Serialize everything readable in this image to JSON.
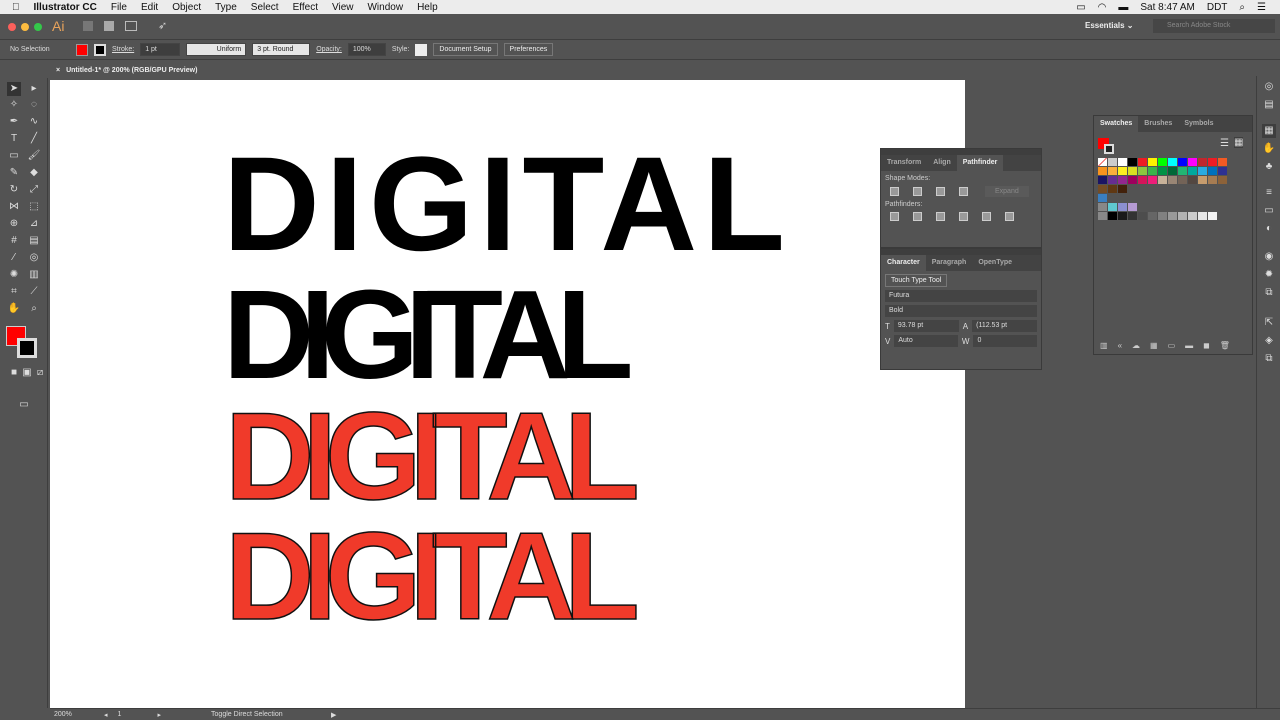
{
  "menubar": {
    "app": "Illustrator CC",
    "items": [
      "File",
      "Edit",
      "Object",
      "Type",
      "Select",
      "Effect",
      "View",
      "Window",
      "Help"
    ],
    "clock": "Sat 8:47 AM",
    "tz": "DDT"
  },
  "appbar": {
    "logo": "Ai",
    "workspace": "Essentials",
    "search_placeholder": "Search Adobe Stock"
  },
  "control": {
    "selection": "No Selection",
    "stroke_label": "Stroke:",
    "stroke_value": "1 pt",
    "profile": "Uniform",
    "brush": "3 pt. Round",
    "opacity_label": "Opacity:",
    "opacity_value": "100%",
    "style_label": "Style:",
    "doc_setup": "Document Setup",
    "preferences": "Preferences",
    "fill_color": "#ff0000"
  },
  "document": {
    "tab": "Untitled-1* @ 200% (RGB/GPU Preview)"
  },
  "artwork": {
    "words": [
      "DIGITAL",
      "DIGITAL",
      "DIGITAL",
      "DIGITAL"
    ],
    "red": "#f03a2a"
  },
  "pathfinder": {
    "tabs": [
      "Transform",
      "Align",
      "Pathfinder"
    ],
    "shape_modes": "Shape Modes:",
    "expand": "Expand",
    "pathfinders": "Pathfinders:"
  },
  "character": {
    "tabs": [
      "Character",
      "Paragraph",
      "OpenType"
    ],
    "touch_type": "Touch Type Tool",
    "font": "Futura",
    "style": "Bold",
    "size": "93.78 pt",
    "leading": "(112.53 pt",
    "kerning": "Auto",
    "tracking": "0"
  },
  "swatches": {
    "tabs": [
      "Swatches",
      "Brushes",
      "Symbols"
    ],
    "colors": [
      "#ffffff",
      "#000000",
      "#ed1c24",
      "#fff200",
      "#00ff00",
      "#00ffff",
      "#0000ff",
      "#ff00ff",
      "#c1272d",
      "#ed1c24",
      "#f15a24",
      "#f7931e",
      "#fbb03b",
      "#fcee21",
      "#d9e021",
      "#8cc63f",
      "#39b54a",
      "#009245",
      "#006837",
      "#22b573",
      "#00a99d",
      "#29abe2",
      "#0071bc",
      "#2e3192",
      "#1b1464",
      "#662d91",
      "#93278f",
      "#9e005d",
      "#d4145a",
      "#ed1e79",
      "#c7b299",
      "#998675",
      "#736357",
      "#534741",
      "#c69c6d",
      "#a67c52",
      "#8c6239",
      "#754c24",
      "#603813",
      "#42210b"
    ],
    "group1": [
      "#5fc8d0",
      "#8b8fd1",
      "#b59ad3"
    ],
    "grays": [
      "#000000",
      "#1a1a1a",
      "#333333",
      "#4d4d4d",
      "#666666",
      "#808080",
      "#999999",
      "#b3b3b3",
      "#cccccc",
      "#e6e6e6",
      "#f2f2f2"
    ]
  },
  "status": {
    "zoom": "200%",
    "page": "1",
    "info": "Toggle Direct Selection"
  }
}
